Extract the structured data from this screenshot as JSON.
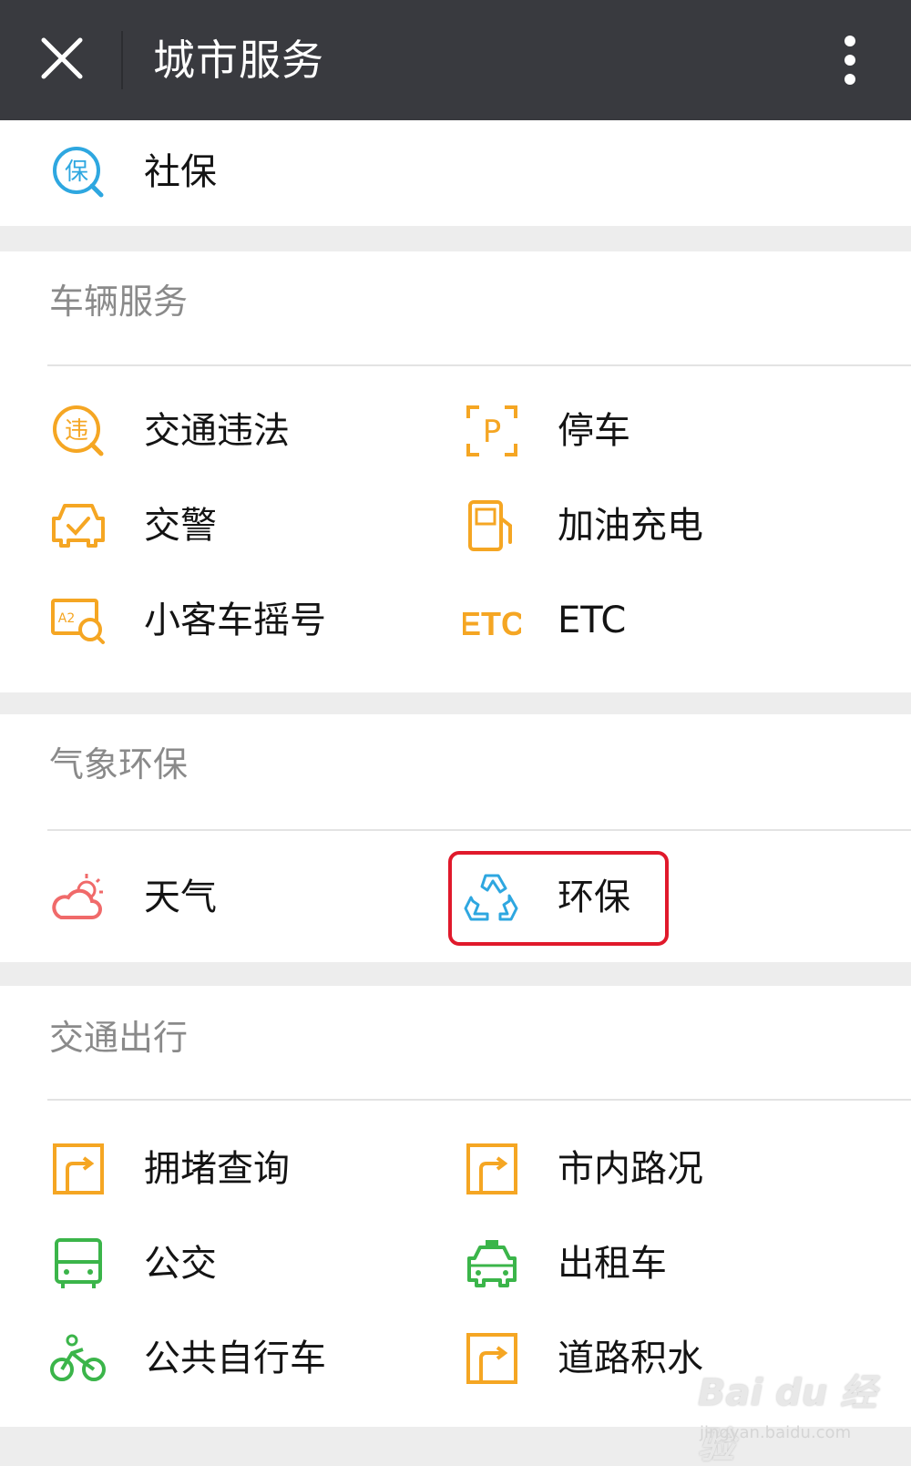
{
  "header": {
    "title": "城市服务",
    "close_icon": "close-icon",
    "more_icon": "more-vertical-icon",
    "background": "#393a3f"
  },
  "top_item": {
    "label": "社保",
    "icon": "social-security-icon",
    "color": "#2ea7e0"
  },
  "vehicle": {
    "title": "车辆服务",
    "items": [
      {
        "label": "交通违法",
        "icon": "traffic-violation-icon"
      },
      {
        "label": "停车",
        "icon": "parking-icon"
      },
      {
        "label": "交警",
        "icon": "traffic-police-icon"
      },
      {
        "label": "加油充电",
        "icon": "fuel-charging-icon"
      },
      {
        "label": "小客车摇号",
        "icon": "car-lottery-icon"
      },
      {
        "label": "ETC",
        "icon": "etc-icon",
        "icon_text": "ETC"
      }
    ],
    "color": "#f5a623"
  },
  "weather_env": {
    "title": "气象环保",
    "items": [
      {
        "label": "天气",
        "icon": "weather-icon",
        "color": "#f06a6a"
      },
      {
        "label": "环保",
        "icon": "recycle-icon",
        "color": "#2ea7e0",
        "highlighted": true
      }
    ],
    "highlight_color": "#e0192b"
  },
  "transport": {
    "title": "交通出行",
    "items": [
      {
        "label": "拥堵查询",
        "icon": "congestion-icon"
      },
      {
        "label": "市内路况",
        "icon": "road-condition-icon"
      },
      {
        "label": "公交",
        "icon": "bus-icon"
      },
      {
        "label": "出租车",
        "icon": "taxi-icon"
      },
      {
        "label": "公共自行车",
        "icon": "bicycle-icon"
      },
      {
        "label": "道路积水",
        "icon": "road-flooding-icon"
      }
    ],
    "orange": "#f5a623",
    "green": "#3bb54a"
  },
  "watermark": {
    "main": "Bai du 经验",
    "sub": "jingyan.baidu.com"
  }
}
